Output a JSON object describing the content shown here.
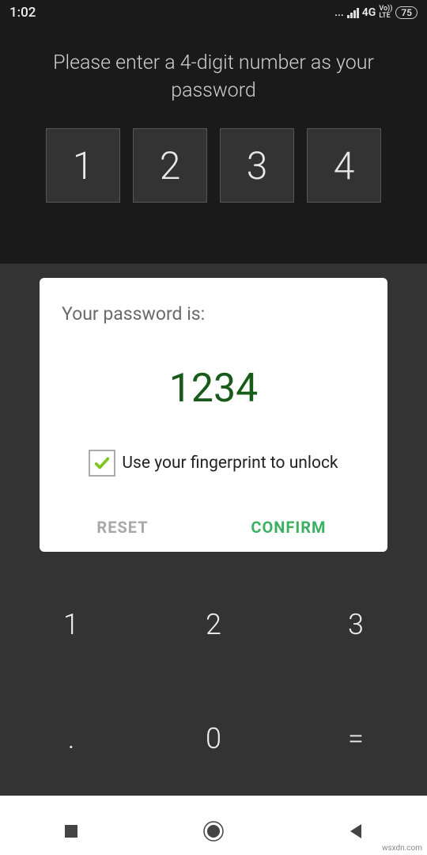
{
  "status_bar": {
    "time": "1:02",
    "dots": "...",
    "network": "4G",
    "volte": "Vo)) LTE",
    "battery": "75"
  },
  "instruction": "Please enter a 4-digit number as your password",
  "digits": [
    "1",
    "2",
    "3",
    "4"
  ],
  "card": {
    "label": "Your password is:",
    "password": "1234",
    "fingerprint_label": "Use your fingerprint to unlock",
    "reset": "RESET",
    "confirm": "CONFIRM"
  },
  "keys": {
    "k1": "1",
    "k2": "2",
    "k3": "3",
    "kdot": ".",
    "k0": "0",
    "keq": "="
  },
  "watermark": "wsxdn.com"
}
